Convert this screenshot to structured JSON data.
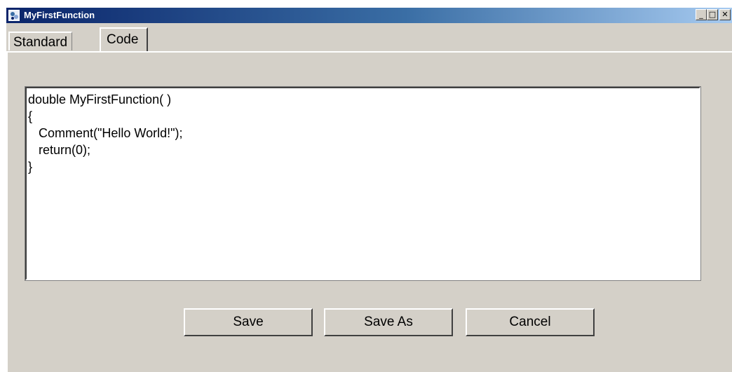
{
  "window": {
    "title": "MyFirstFunction",
    "controls": {
      "minimize": "_",
      "maximize": "□",
      "close": "✕"
    }
  },
  "tabs": [
    {
      "label": "Standard",
      "active": false
    },
    {
      "label": "Code",
      "active": true
    }
  ],
  "editor": {
    "code": "double MyFirstFunction( )\n{\n   Comment(\"Hello World!\");\n   return(0);\n}"
  },
  "buttons": {
    "save": "Save",
    "save_as": "Save As",
    "cancel": "Cancel"
  },
  "colors": {
    "titlebar_start": "#0a246a",
    "titlebar_end": "#a6caf0",
    "face": "#d4d0c8"
  },
  "icons": {
    "app": "app-icon",
    "minimize": "minimize-icon",
    "maximize": "maximize-icon",
    "close": "close-icon"
  }
}
